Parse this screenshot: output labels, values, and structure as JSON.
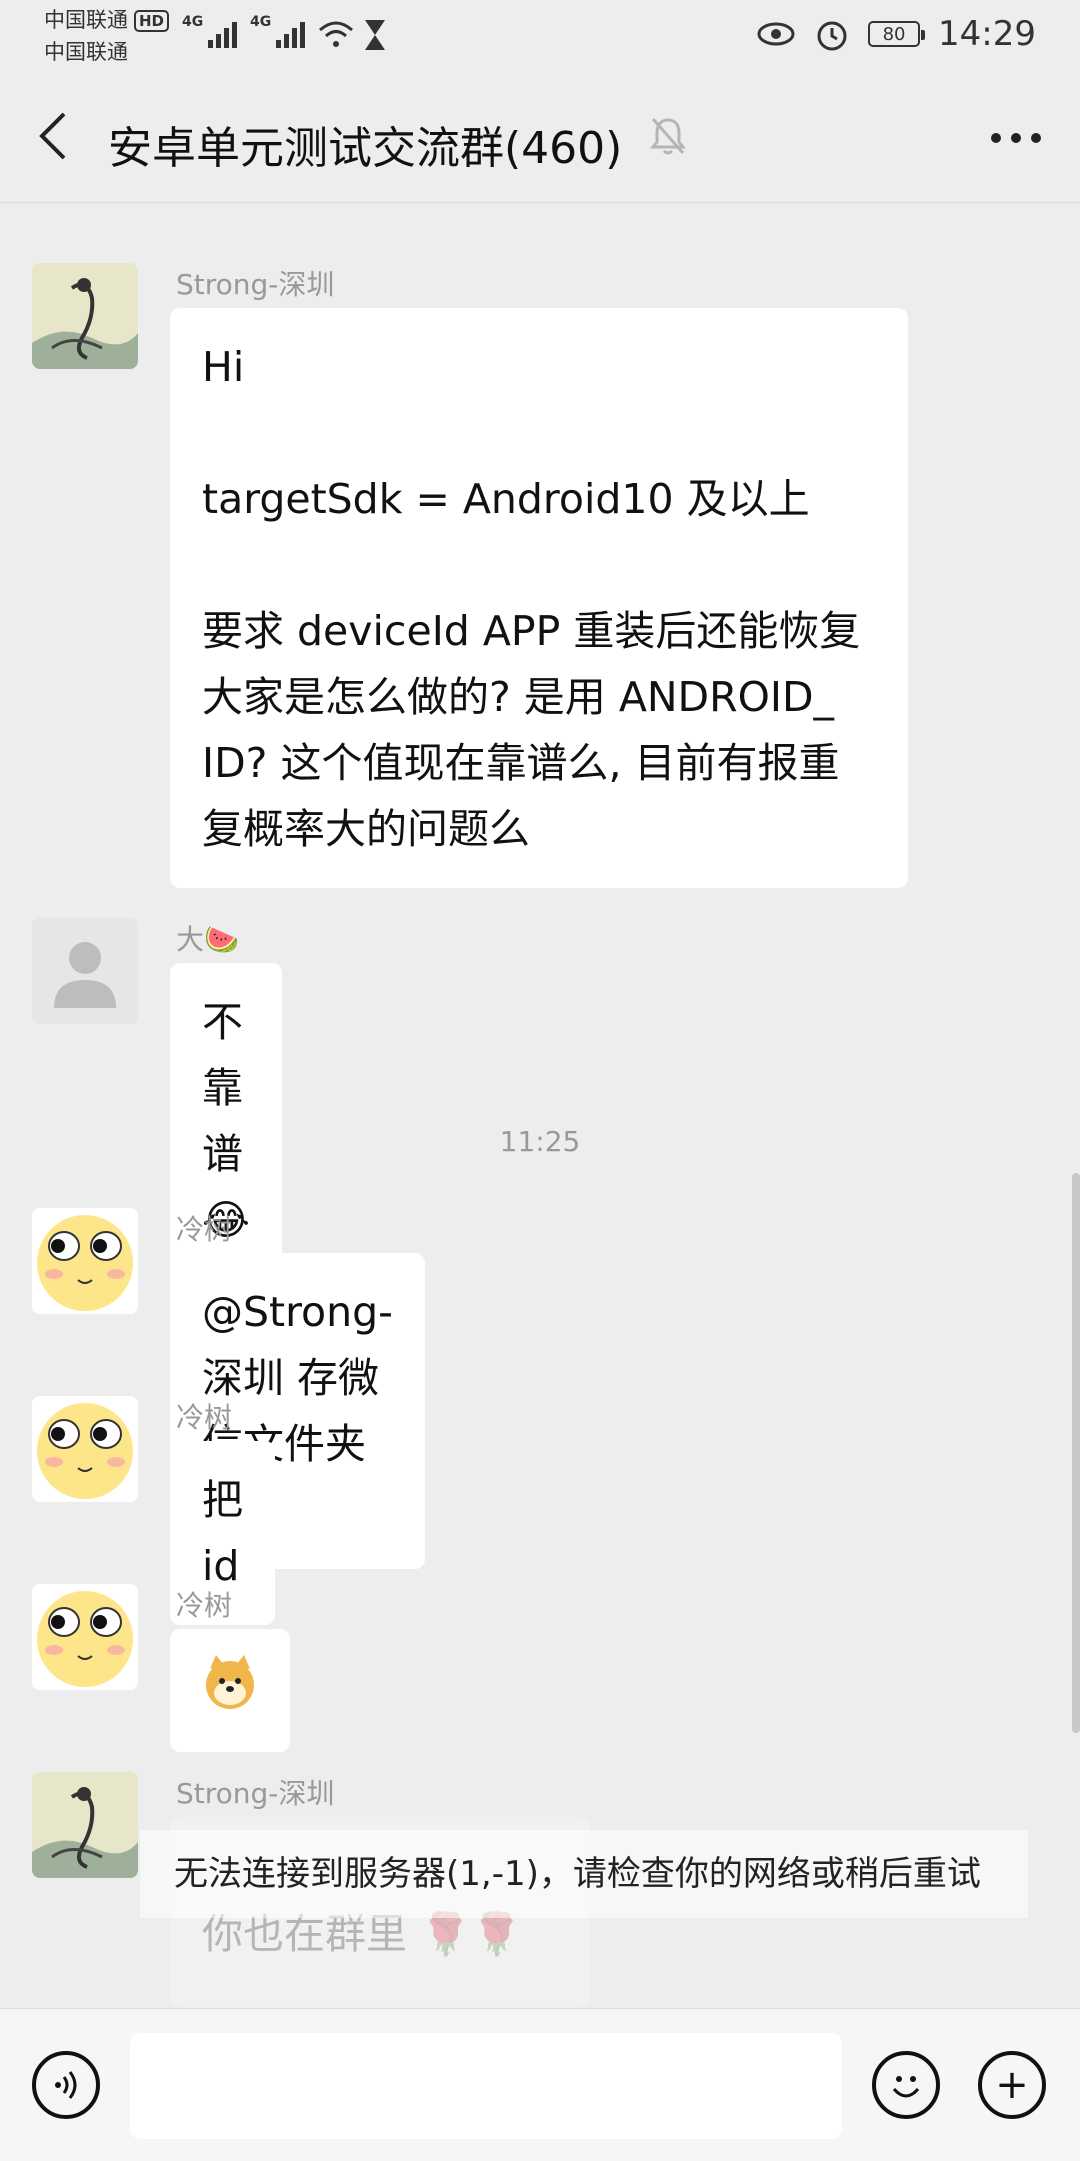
{
  "status_bar": {
    "carrier_1": "中国联通",
    "carrier_1_badge": "HD",
    "carrier_2": "中国联通",
    "signal_1_label": "4G",
    "signal_2_label": "4G",
    "battery": "80",
    "time": "14:29",
    "icons": [
      "eye-icon",
      "alarm-icon",
      "hourglass-icon",
      "wifi-icon",
      "signal-icon"
    ]
  },
  "header": {
    "back_icon": "‹",
    "title": "安卓单元测试交流群(460)",
    "mute_icon": "bell-off-icon",
    "more_icon": "•••"
  },
  "messages": [
    {
      "sender": "Strong-深圳",
      "avatar": "ink-painting-avatar",
      "lines": [
        "Hi",
        "",
        "targetSdk = Android10 及以上",
        "",
        "要求 deviceId APP 重装后还能恢复",
        "大家是怎么做的? 是用 ANDROID_",
        "ID? 这个值现在靠谱么, 目前有报重",
        "复概率大的问题么"
      ]
    },
    {
      "sender": "大🍉",
      "avatar": "default-user-avatar",
      "text": "不靠谱😂😂😂"
    },
    {
      "sender": "冷树",
      "avatar": "emoji-face-avatar",
      "text": "@Strong-深圳  存微信文件夹里"
    },
    {
      "sender": "冷树",
      "avatar": "emoji-face-avatar",
      "text": "把 id"
    },
    {
      "sender": "冷树",
      "avatar": "emoji-face-avatar",
      "text": "🐶"
    },
    {
      "sender": "Strong-深圳",
      "avatar": "ink-painting-avatar",
      "text": "你也在群里 🌹🌹"
    }
  ],
  "timestamp_divider": "11:25",
  "toast": {
    "message": "无法连接到服务器(1,-1)，请检查你的网络或稍后重试"
  },
  "input_bar": {
    "voice_icon": "voice-icon",
    "emoji_icon": "emoji-icon",
    "plus_icon": "+"
  }
}
